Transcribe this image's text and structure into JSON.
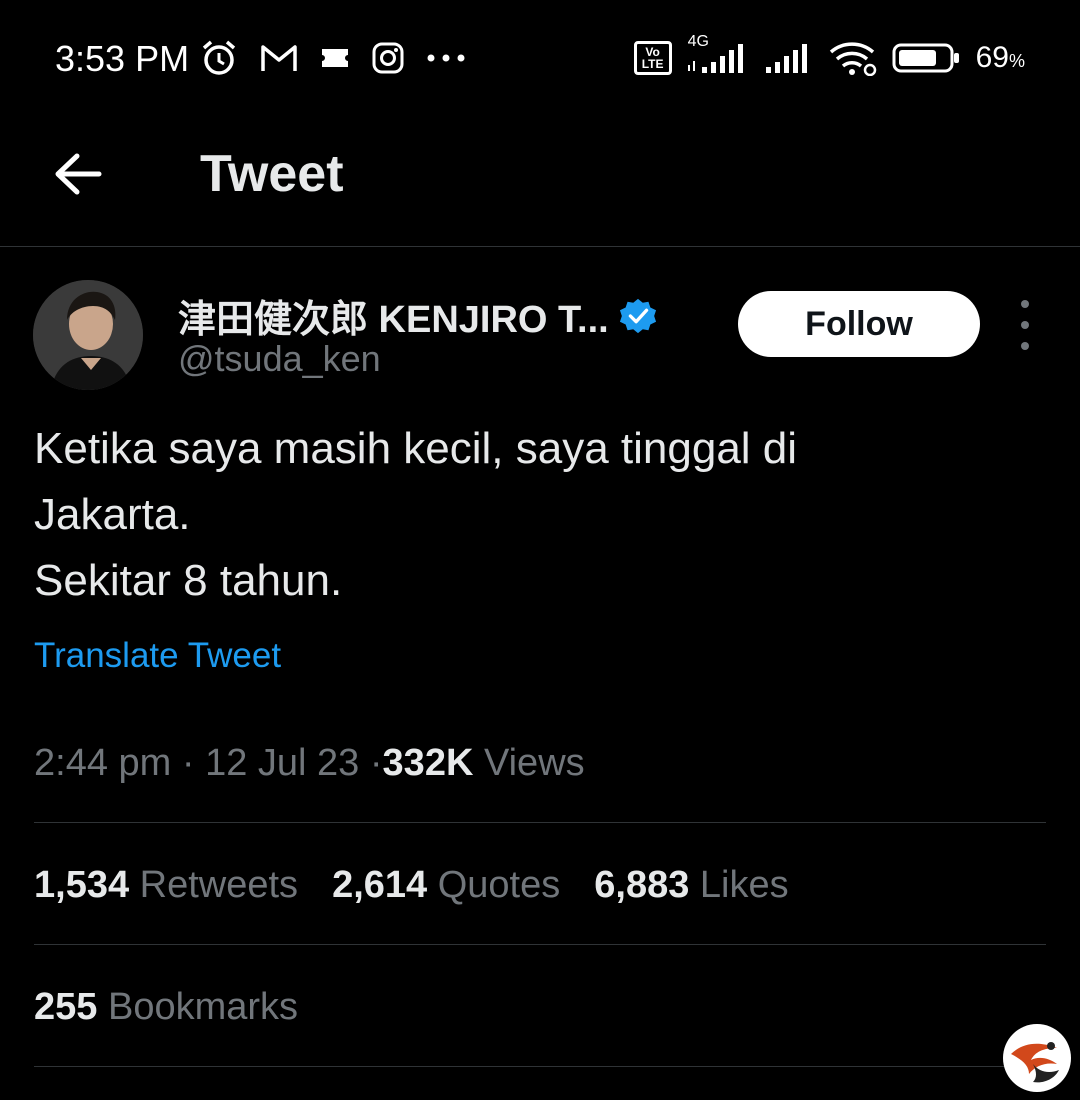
{
  "status_bar": {
    "time": "3:53 PM",
    "left_icons": [
      "alarm-icon",
      "gmail-icon",
      "ticket-icon",
      "instagram-icon",
      "more-notifications-icon"
    ],
    "network_badge": "Vo LTE",
    "network_type": "4G",
    "battery_percent": "69",
    "battery_unit": "%"
  },
  "header": {
    "back_icon": "arrow-left-icon",
    "title": "Tweet"
  },
  "tweet": {
    "author_name": "津田健次郎 KENJIRO T...",
    "verified_icon": "verified-badge-icon",
    "handle": "@tsuda_ken",
    "follow_label": "Follow",
    "more_icon": "more-vertical-icon",
    "text_lines": [
      "Ketika saya masih kecil, saya tinggal di",
      "Jakarta.",
      "Sekitar 8 tahun."
    ],
    "translate_label": "Translate Tweet",
    "time": "2:44 pm",
    "date": "12 Jul 23",
    "separator": "·",
    "views_count": "332K",
    "views_label": "Views"
  },
  "stats": {
    "retweets_count": "1,534",
    "retweets_label": "Retweets",
    "quotes_count": "2,614",
    "quotes_label": "Quotes",
    "likes_count": "6,883",
    "likes_label": "Likes",
    "bookmarks_count": "255",
    "bookmarks_label": "Bookmarks"
  },
  "colors": {
    "background": "#000000",
    "text_primary": "#e7e9ea",
    "text_secondary": "#71767b",
    "link": "#1d9bf0",
    "divider": "#2f3336",
    "verified": "#1d9bf0"
  }
}
